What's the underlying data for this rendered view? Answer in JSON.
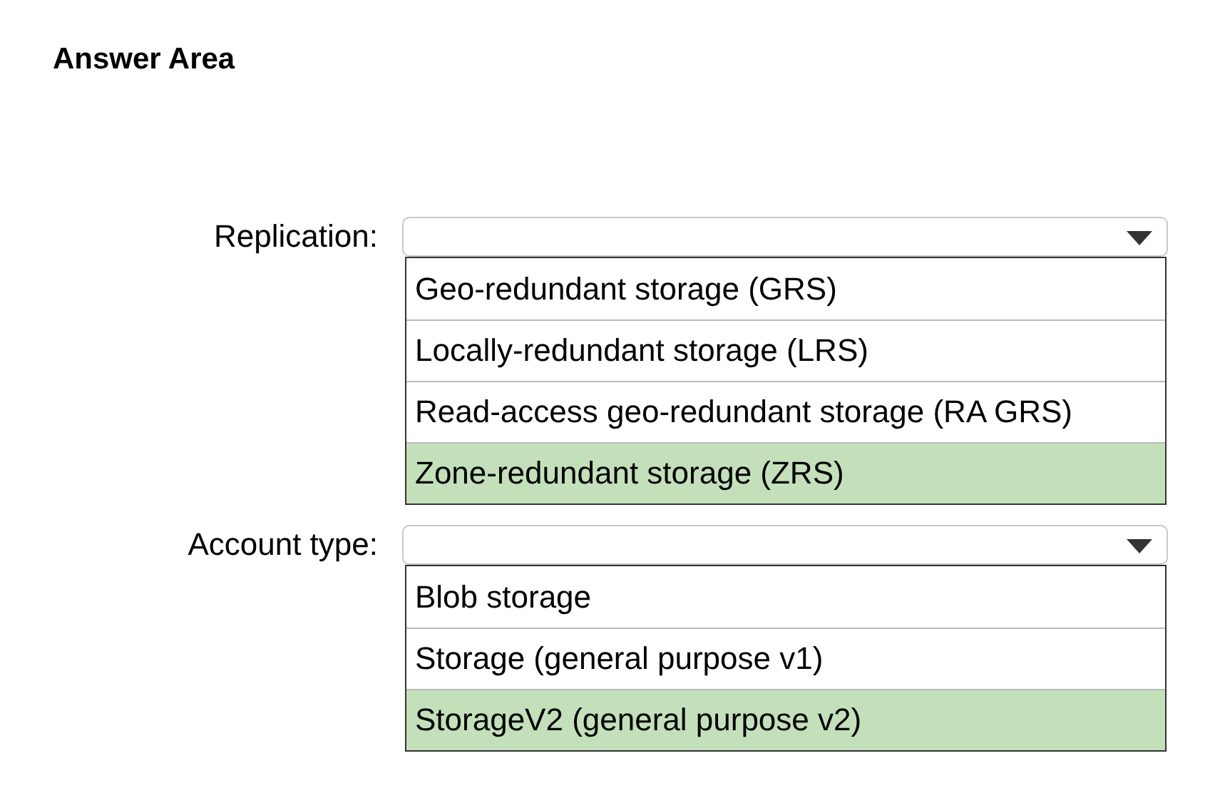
{
  "title": "Answer Area",
  "questions": [
    {
      "label": "Replication:",
      "options": [
        {
          "text": "Geo-redundant storage (GRS)",
          "selected": false
        },
        {
          "text": "Locally-redundant storage (LRS)",
          "selected": false
        },
        {
          "text": "Read-access geo-redundant storage (RA GRS)",
          "selected": false
        },
        {
          "text": "Zone-redundant storage (ZRS)",
          "selected": true
        }
      ]
    },
    {
      "label": "Account type:",
      "options": [
        {
          "text": "Blob storage",
          "selected": false
        },
        {
          "text": "Storage (general purpose v1)",
          "selected": false
        },
        {
          "text": "StorageV2 (general purpose v2)",
          "selected": true
        }
      ]
    }
  ]
}
